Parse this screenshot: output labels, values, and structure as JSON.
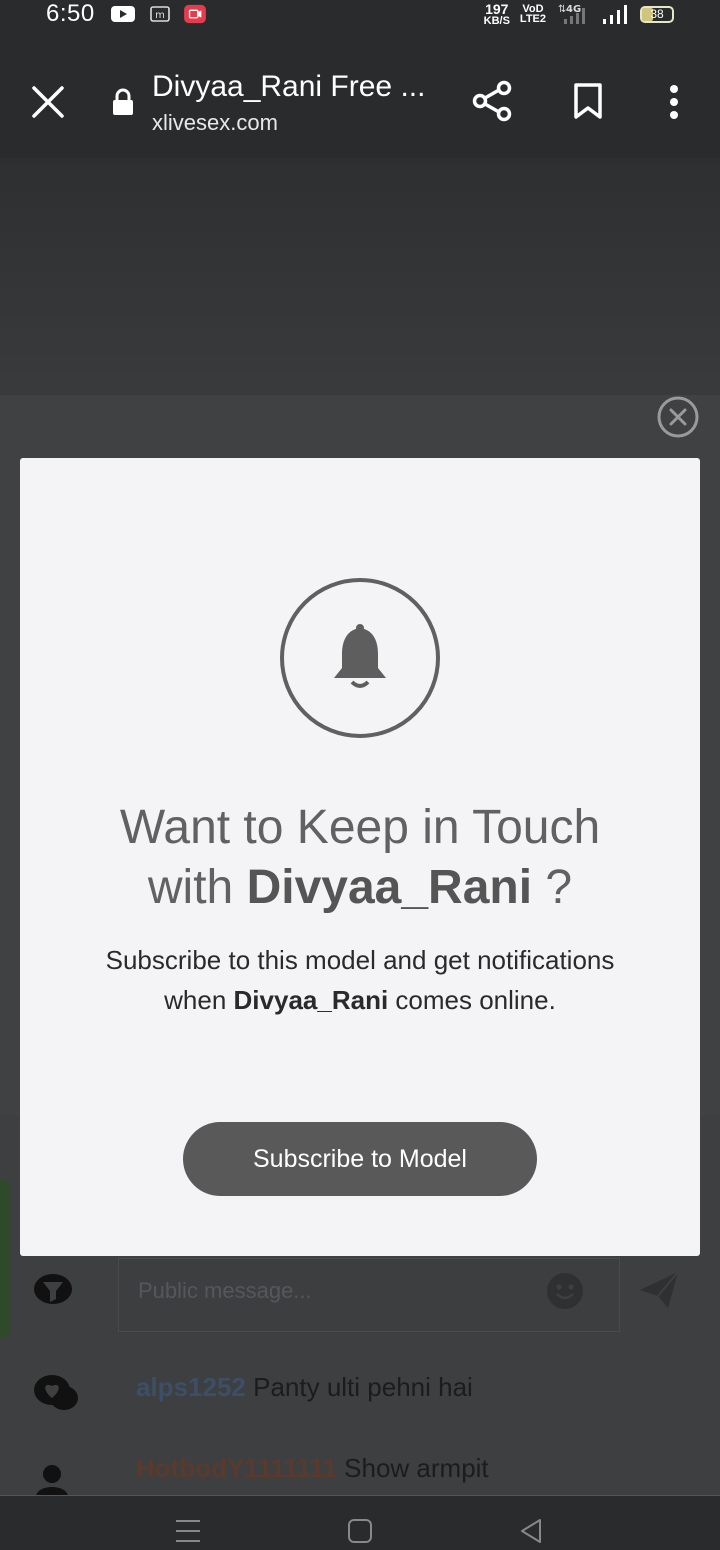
{
  "status_bar": {
    "time": "6:50",
    "net_speed_top": "197",
    "net_speed_bottom": "KB/S",
    "volte_top": "VoD",
    "volte_bottom": "LTE2",
    "network": "4G",
    "battery": "38"
  },
  "browser_bar": {
    "title": "Divyaa_Rani Free ...",
    "url": "xlivesex.com"
  },
  "modal": {
    "headline_line1": "Want to Keep in Touch",
    "headline_with": "with ",
    "model_name": "Divyaa_Rani",
    "headline_end": " ?",
    "desc_part1": "Subscribe to this model and get notifications when ",
    "desc_name": "Divyaa_Rani",
    "desc_part2": " comes online.",
    "button_label": "Subscribe to Model"
  },
  "chat": {
    "input_placeholder": "Public message...",
    "messages": [
      {
        "user": "alps1252",
        "text": "Panty ulti pehni hai"
      },
      {
        "user": "HotbodY1111111",
        "text": "Show armpit"
      }
    ]
  },
  "colors": {
    "modal_bg": "#f4f4f6",
    "button_bg": "#595959",
    "bar_bg": "#2a2b2d"
  }
}
